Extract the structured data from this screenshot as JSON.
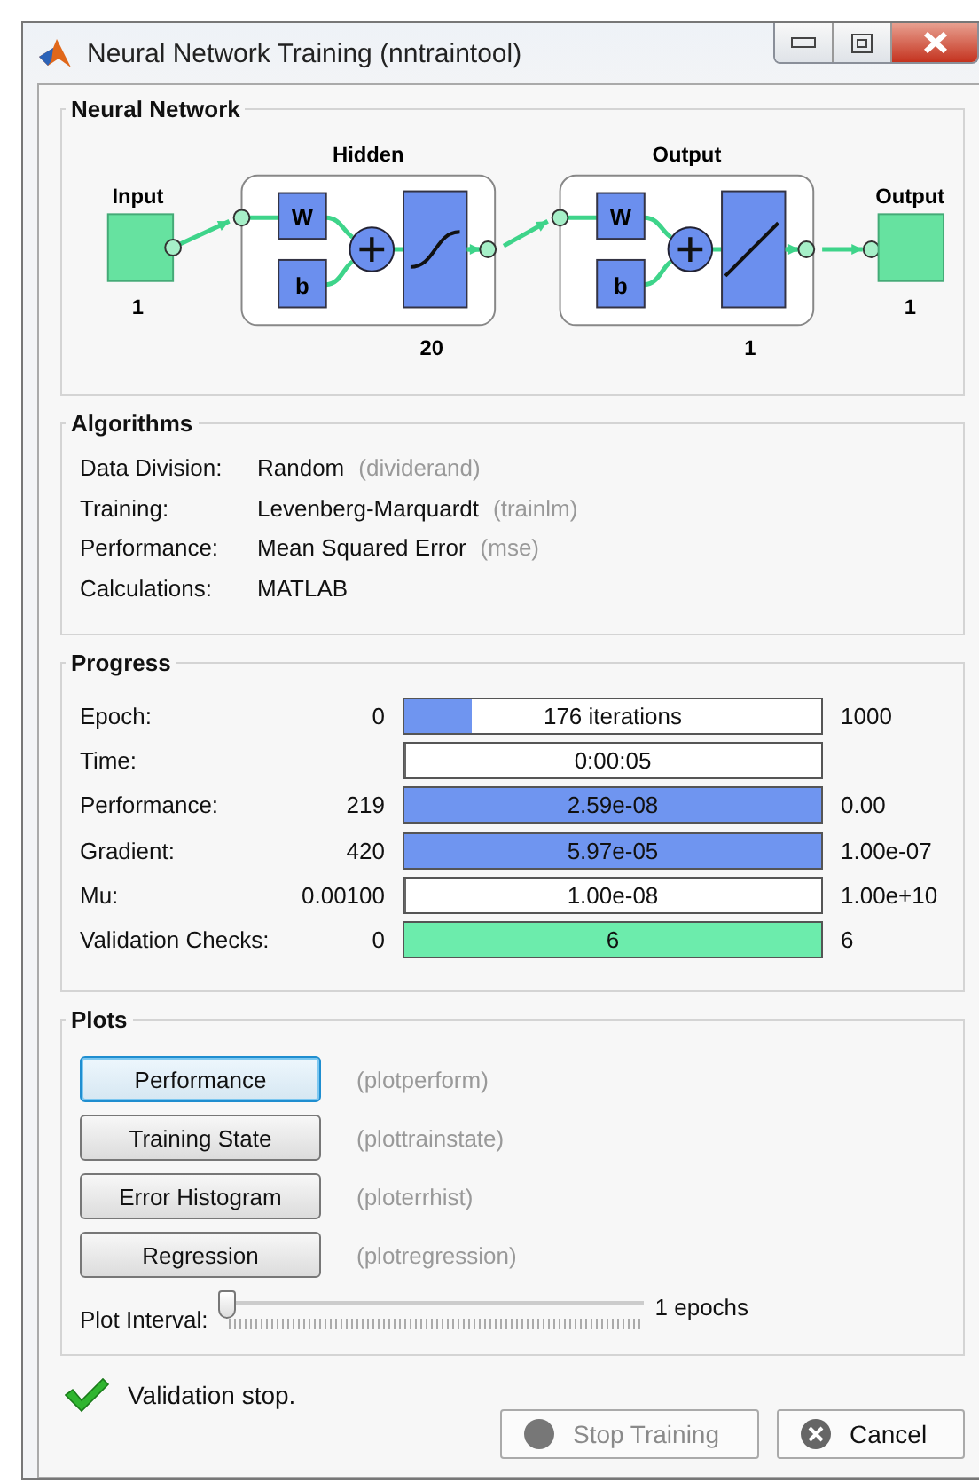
{
  "window": {
    "title": "Neural Network Training (nntraintool)"
  },
  "network": {
    "title": "Neural Network",
    "input": {
      "label": "Input",
      "size": "1"
    },
    "layers": [
      {
        "label": "Hidden",
        "size": "20",
        "weight": "W",
        "bias": "b",
        "kind": "sigmoid"
      },
      {
        "label": "Output",
        "size": "1",
        "weight": "W",
        "bias": "b",
        "kind": "linear"
      }
    ],
    "output": {
      "label": "Output",
      "size": "1"
    }
  },
  "algorithms": {
    "title": "Algorithms",
    "rows": [
      {
        "label": "Data Division:",
        "value": "Random",
        "function": "(dividerand)"
      },
      {
        "label": "Training:",
        "value": "Levenberg-Marquardt",
        "function": "(trainlm)"
      },
      {
        "label": "Performance:",
        "value": "Mean Squared Error",
        "function": "(mse)"
      },
      {
        "label": "Calculations:",
        "value": "MATLAB"
      }
    ]
  },
  "progress": {
    "title": "Progress",
    "rows": [
      {
        "label": "Epoch:",
        "start": "0",
        "reading": "176 iterations",
        "end": "1000",
        "level": 0.16,
        "color": "#6f95f0"
      },
      {
        "label": "Time:",
        "reading": "0:00:05",
        "level": 0
      },
      {
        "label": "Performance:",
        "start": "219",
        "reading": "2.59e-08",
        "end": "0.00",
        "level": 1,
        "color": "#6f95f0"
      },
      {
        "label": "Gradient:",
        "start": "420",
        "reading": "5.97e-05",
        "end": "1.00e-07",
        "level": 1,
        "color": "#6f95f0"
      },
      {
        "label": "Mu:",
        "start": "0.00100",
        "reading": "1.00e-08",
        "end": "1.00e+10",
        "level": 0
      },
      {
        "label": "Validation Checks:",
        "start": "0",
        "reading": "6",
        "end": "6",
        "level": 1,
        "color": "#6cecac"
      }
    ]
  },
  "plots": {
    "title": "Plots",
    "buttons": [
      {
        "label": "Performance",
        "function": "(plotperform)",
        "selected": true
      },
      {
        "label": "Training State",
        "function": "(plottrainstate)",
        "selected": false
      },
      {
        "label": "Error Histogram",
        "function": "(ploterrhist)",
        "selected": false
      },
      {
        "label": "Regression",
        "function": "(plotregression)",
        "selected": false
      }
    ],
    "interval": {
      "label": "Plot Interval:",
      "level": 0,
      "reading": "1 epochs"
    }
  },
  "status": {
    "message": "Validation stop.",
    "buttons": [
      {
        "label": "Stop Training",
        "kind": "stop",
        "disabled": true
      },
      {
        "label": "Cancel",
        "kind": "cancel",
        "disabled": false
      }
    ]
  }
}
